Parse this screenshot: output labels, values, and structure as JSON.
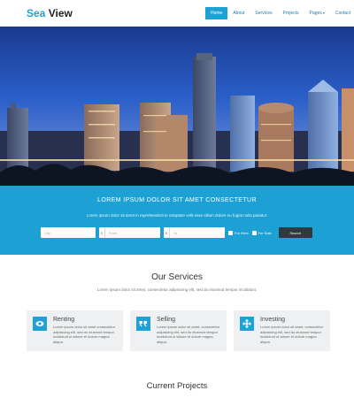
{
  "logo": {
    "part1": "Sea",
    "part2": "View"
  },
  "nav": {
    "items": [
      {
        "label": "Home"
      },
      {
        "label": "About"
      },
      {
        "label": "Services"
      },
      {
        "label": "Projects"
      },
      {
        "label": "Pages"
      },
      {
        "label": "Contact"
      }
    ]
  },
  "search": {
    "title": "LOREM IPSUM DOLOR SIT AMET CONSECTETUR",
    "subtitle": "Lorem ipsum dolor sit amet in reprehenderit in voluptate velit esse cillum dolore eu fugiat nulla pariatur.",
    "city_placeholder": "City",
    "from_prefix": "$",
    "from_placeholder": "From",
    "to_prefix": "$",
    "to_placeholder": "To",
    "for_rent_label": "For Rent",
    "for_sale_label": "For Sale",
    "button_label": "Search"
  },
  "services": {
    "title": "Our Services",
    "subtitle": "Lorem ipsum dolor sit amet, consectetur adipisicing elit, sed do eiusmod tempor incididunt.",
    "cards": [
      {
        "title": "Renting",
        "text": "Lorem ipsum dolor sit amet consectetur adipisicing elit, sed do eiusmod tempor incididunt ut labore et dolore magna aliqua.",
        "icon": "eye-icon"
      },
      {
        "title": "Selling",
        "text": "Lorem ipsum dolor sit amet, consectetur adipisicing elit, sed do eiusmod tempor incididunt ut labore et dolore magna aliqua.",
        "icon": "quote-icon"
      },
      {
        "title": "Investing",
        "text": "Lorem ipsum dolor sit amet, consectetur adipisicing elit, sed do eiusmod tempor incididunt ut labore et dolore magna aliqua.",
        "icon": "move-arrows-icon"
      }
    ]
  },
  "projects": {
    "title": "Current Projects"
  },
  "colors": {
    "accent": "#1fa1d6",
    "band": "#1da1d5",
    "dark_button": "#2d3a3f",
    "card_bg": "#eef0f1"
  }
}
